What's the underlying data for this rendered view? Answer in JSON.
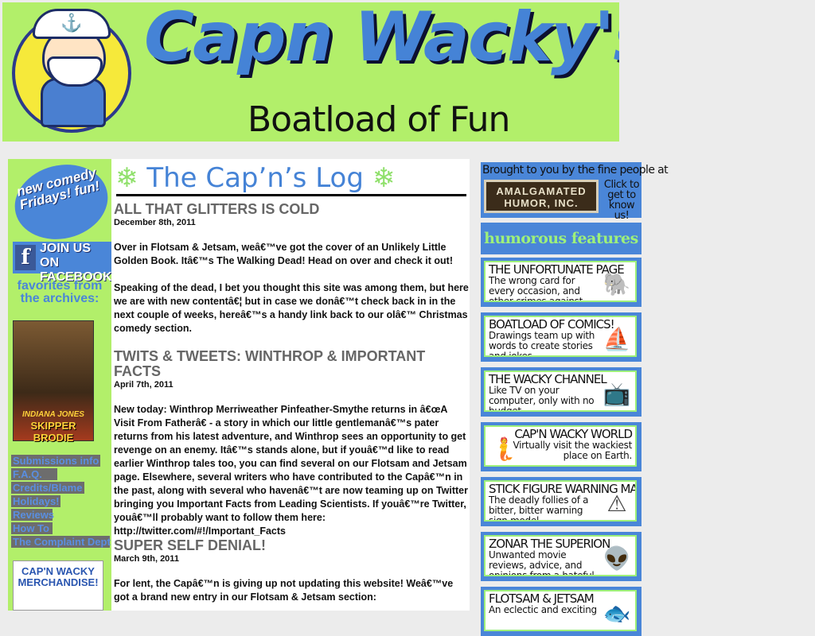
{
  "header": {
    "title": "Capn Wacky's",
    "subtitle": "Boatload of Fun",
    "hat_glyph": "⚓"
  },
  "left": {
    "badge": "new comedy Fridays! fun!",
    "facebook_icon": "f",
    "facebook": "JOIN US ON FACEBOOK",
    "favorites": "favorites from the archives:",
    "poster_line1": "INDIANA JONES",
    "poster_line2": "SKIPPER BRODIE",
    "links": [
      "Submissions info",
      "F.A.Q.",
      "Credits/Blame",
      "Holidays!",
      "Reviews",
      "How To",
      "The Complaint Dept"
    ],
    "merch": "CAP'N WACKY MERCHANDISE!"
  },
  "main": {
    "snow": "❄",
    "title": "The Cap’n’s Log",
    "posts": [
      {
        "title": "ALL THAT GLITTERS IS COLD",
        "date": "December 8th, 2011",
        "paras": [
          "Over in Flotsam & Jetsam, weâ€™ve got the cover of an Unlikely Little Golden Book. Itâ€™s The Walking Dead! Head on over and check it out!",
          "Speaking of the dead, I bet you thought this site was among them, but here we are with new contentâ€¦ but in case we donâ€™t check back in in the next couple of weeks, hereâ€™s a handy link back to our olâ€™ Christmas comedy section."
        ]
      },
      {
        "title": "TWITS & TWEETS: WINTHROP & IMPORTANT FACTS",
        "date": "April 7th, 2011",
        "paras": [
          "New today: Winthrop Merriweather Pinfeather-Smythe returns in â€œA Visit From Fatherâ€ - a story in which our little gentlemanâ€™s pater returns from his latest adventure, and Winthrop sees an opportunity to get revenge on an enemy. Itâ€™s stands alone, but if youâ€™d like to read earlier Winthrop tales too, you can find several on our Flotsam and Jetsam page. Elsewhere, several writers who have contributed to the Capâ€™n in the past, along with several who havenâ€™t are now teaming up on Twitter bringing you Important Facts from Leading Scientists. If youâ€™re Twitter, youâ€™ll probably want to follow them here: http://twitter.com/#!/Important_Facts"
        ]
      },
      {
        "title": "SUPER SELF DENIAL!",
        "date": "March 9th, 2011",
        "paras": [
          "For lent, the Capâ€™n is giving up not updating this website! Weâ€™ve got a brand new entry in our Flotsam & Jetsam section:"
        ]
      }
    ]
  },
  "right": {
    "sponsor_line": "Brought to you by the fine people at",
    "sponsor_name": "AMALGAMATED HUMOR, INC.",
    "sponsor_cta": "Click to get to know us!",
    "features_heading": "humorous features",
    "features": [
      {
        "title": "THE UNFORTUNATE PAGE",
        "desc": "The wrong card for every occasion, and other crimes against good taste.",
        "icon": "card-icon",
        "glyph": "🐘"
      },
      {
        "title": "BOATLOAD OF COMICS!",
        "desc": "Drawings team up with words to create stories and jokes.",
        "icon": "comic-captain-icon",
        "glyph": "⛵"
      },
      {
        "title": "THE WACKY CHANNEL",
        "desc": "Like TV on your computer, only with no budget.",
        "icon": "tv-icon",
        "glyph": "📺"
      },
      {
        "title": "CAP'N WACKY WORLD",
        "desc": "Virtually visit the wackiest place on Earth.",
        "icon": "mermaid-icon",
        "glyph": "🧜"
      },
      {
        "title": "STICK FIGURE WARNING MAN",
        "desc": "The deadly follies of a bitter, bitter warning sign model.",
        "icon": "warning-sign-icon",
        "glyph": "⚠"
      },
      {
        "title": "ZONAR THE SUPERION",
        "desc": "Unwanted movie reviews, advice, and opinions from a hateful alien columnist.",
        "icon": "alien-icon",
        "glyph": "👽"
      },
      {
        "title": "FLOTSAM & JETSAM",
        "desc": "An eclectic and exciting",
        "icon": "flotsam-icon",
        "glyph": "🐟"
      }
    ]
  }
}
